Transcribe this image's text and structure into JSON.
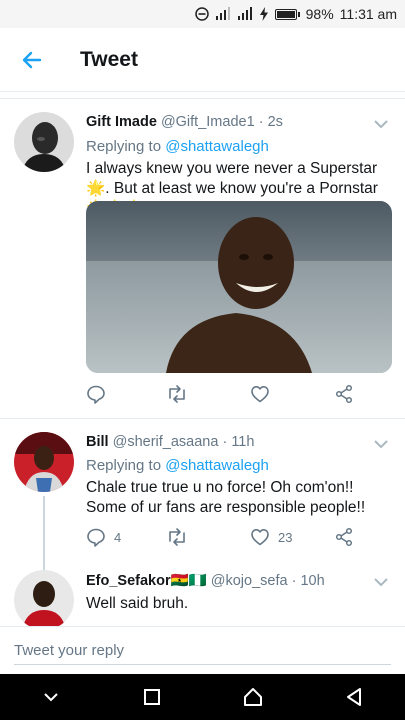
{
  "status_bar": {
    "battery": "98%",
    "time": "11:31 am",
    "icons": [
      "minus-circle-icon",
      "signal-icon",
      "signal-3g-icon",
      "charging-bolt-icon",
      "battery-icon"
    ]
  },
  "header": {
    "title": "Tweet",
    "back_icon": "arrow-left-icon"
  },
  "tweets": [
    {
      "name": "Gift Imade",
      "handle": "@Gift_Imade1",
      "dot": "·",
      "time": "2s",
      "replying_label": "Replying to",
      "replying_to": "@shattawalegh",
      "text": "I always knew you were never a Superstar 🌟. But at least we know you're a Pornstar 🌟🌟🌟",
      "has_media": true,
      "actions": {
        "reply": "",
        "retweet": "",
        "like": ""
      }
    },
    {
      "name": "Bill",
      "handle": "@sherif_asaana",
      "dot": "·",
      "time": "11h",
      "replying_label": "Replying to",
      "replying_to": "@shattawalegh",
      "text": "Chale true true u no force! Oh com'on!! Some of ur fans are responsible people!!",
      "actions": {
        "reply": "4",
        "retweet": "",
        "like": "23"
      }
    },
    {
      "name": "Efo_Sefakor🇬🇭🇳🇬",
      "handle": "@kojo_sefa",
      "dot": "·",
      "time": "10h",
      "text": "Well said bruh."
    }
  ],
  "reply_bar": {
    "placeholder": "Tweet your reply"
  },
  "nav": [
    "back-triangle-icon",
    "home-circle-icon",
    "recents-square-icon",
    "chevron-down-icon"
  ],
  "colors": {
    "accent": "#1da1f2",
    "muted": "#657786",
    "text": "#14171a"
  }
}
